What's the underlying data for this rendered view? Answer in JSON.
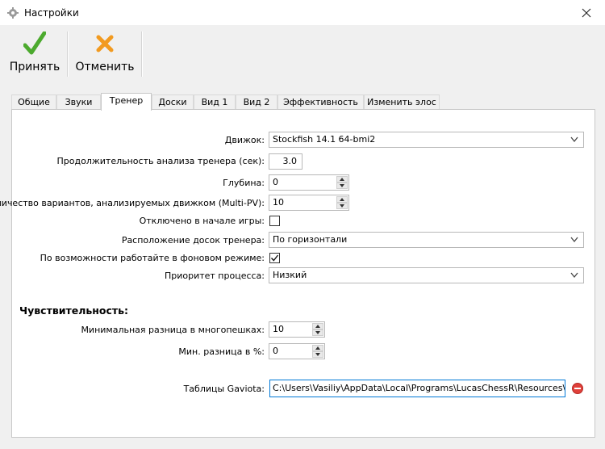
{
  "window": {
    "title": "Настройки"
  },
  "toolbar": {
    "accept_label": "Принять",
    "cancel_label": "Отменить"
  },
  "tabs": [
    "Общие",
    "Звуки",
    "Тренер",
    "Доски",
    "Вид 1",
    "Вид 2",
    "Эффективность",
    "Изменить элос"
  ],
  "active_tab": "Тренер",
  "form": {
    "engine_label": "Движок:",
    "engine_value": "Stockfish 14.1 64-bmi2",
    "duration_label": "Продолжительность анализа тренера (сек):",
    "duration_value": "3.0",
    "depth_label": "Глубина:",
    "depth_value": "0",
    "multipv_label": "Количество вариантов, анализируемых движком (Multi-PV):",
    "multipv_value": "10",
    "disabled_start_label": "Отключено в начале игры:",
    "disabled_start_checked": false,
    "boards_layout_label": "Расположение досок тренера:",
    "boards_layout_value": "По горизонтали",
    "background_label": "По возможности работайте в фоновом режиме:",
    "background_checked": true,
    "priority_label": "Приоритет процесса:",
    "priority_value": "Низкий"
  },
  "sensitivity": {
    "heading": "Чувствительность:",
    "min_diff_label": "Минимальная разница в многопешках:",
    "min_diff_value": "10",
    "min_pct_label": "Мин. разница в %:",
    "min_pct_value": "0"
  },
  "gaviota": {
    "label": "Таблицы Gaviota:",
    "path": "C:\\Users\\Vasiliy\\AppData\\Local\\Programs\\LucasChessR\\Resources\\Gaviota"
  },
  "icons": {
    "app": "gear-icon",
    "close": "close-icon",
    "accept": "checkmark-icon",
    "cancel": "cross-icon",
    "remove": "remove-icon"
  },
  "colors": {
    "accept_green": "#4caa2e",
    "cancel_orange": "#f29a1f",
    "focus_blue": "#0078d7",
    "remove_red": "#e0403a"
  }
}
